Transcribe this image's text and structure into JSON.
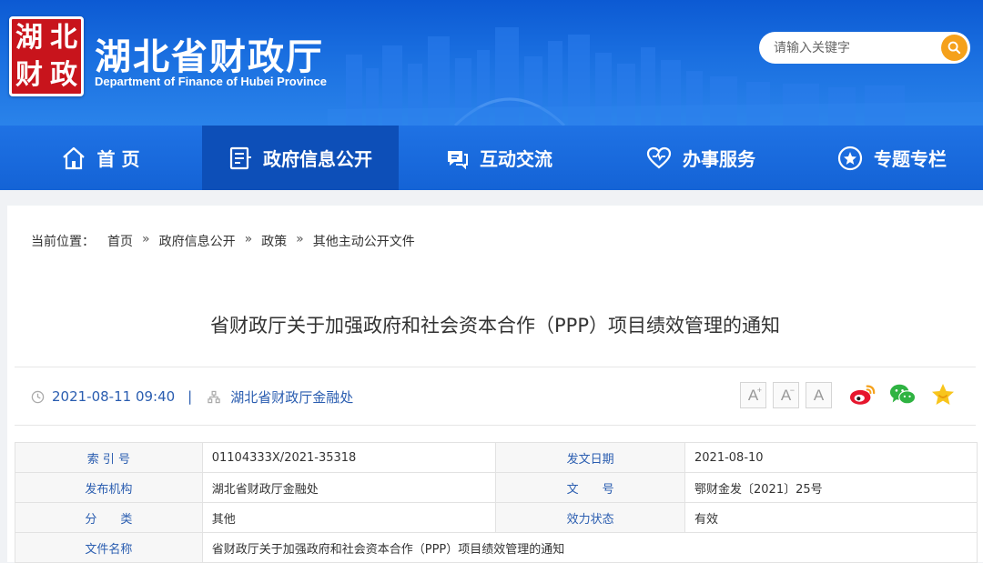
{
  "header": {
    "logo_chars": [
      "湖",
      "北",
      "财",
      "政"
    ],
    "title": "湖北省财政厅",
    "subtitle": "Department of Finance of Hubei Province",
    "search_placeholder": "请输入关键字",
    "search_icon": "search-icon"
  },
  "nav": {
    "items": [
      {
        "label": "首 页",
        "icon": "home-icon"
      },
      {
        "label": "政府信息公开",
        "icon": "document-icon"
      },
      {
        "label": "互动交流",
        "icon": "chat-icon"
      },
      {
        "label": "办事服务",
        "icon": "heart-icon"
      },
      {
        "label": "专题专栏",
        "icon": "star-icon"
      }
    ],
    "active_index": 1
  },
  "breadcrumb": {
    "prefix": "当前位置：",
    "items": [
      "首页",
      "政府信息公开",
      "政策",
      "其他主动公开文件"
    ],
    "separator": "»"
  },
  "article": {
    "title": "省财政厅关于加强政府和社会资本合作（PPP）项目绩效管理的通知",
    "datetime": "2021-08-11 09:40",
    "meta_separator": "|",
    "source": "湖北省财政厅金融处"
  },
  "tools": {
    "font_increase": "A",
    "font_decrease": "A",
    "font_reset": "A",
    "font_increase_mark": "+",
    "font_decrease_mark": "−"
  },
  "info_table": {
    "rows": [
      {
        "label1": "索 引 号",
        "value1": "01104333X/2021-35318",
        "label2": "发文日期",
        "value2": "2021-08-10"
      },
      {
        "label1": "发布机构",
        "value1": "湖北省财政厅金融处",
        "label2": "文　　号",
        "value2": "鄂财金发〔2021〕25号"
      },
      {
        "label1": "分　　类",
        "value1": "其他",
        "label2": "效力状态",
        "value2": "有效"
      },
      {
        "label1": "文件名称",
        "value1": "省财政厅关于加强政府和社会资本合作（PPP）项目绩效管理的通知"
      }
    ]
  },
  "colors": {
    "header_blue": "#1463d6",
    "nav_active": "#0d4fb8",
    "seal_red": "#c8141c",
    "search_orange": "#f5a11b",
    "link_blue": "#2a5db0"
  }
}
